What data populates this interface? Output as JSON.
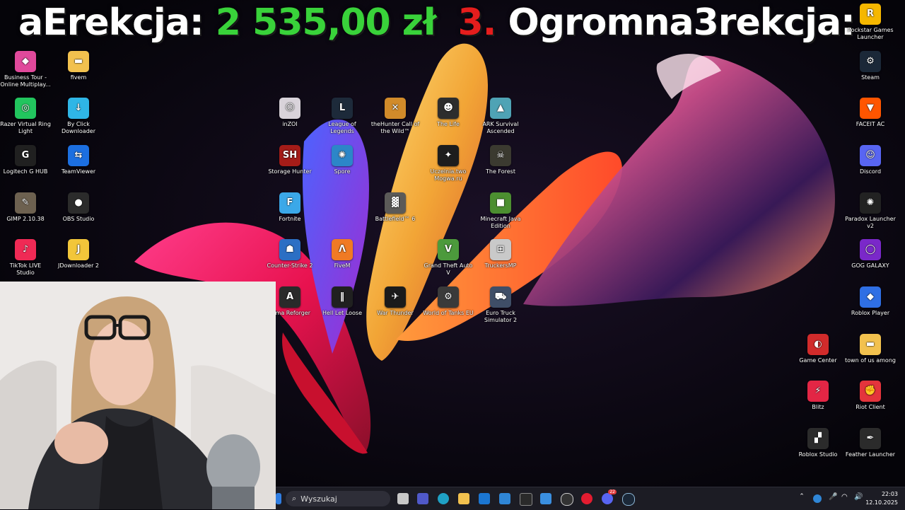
{
  "overlay": {
    "part1": "aErekcja:",
    "amount": "2 535,00 zł",
    "number": "3.",
    "part2": "Ogromna3rekcja:"
  },
  "desktop_icons": [
    {
      "id": "business-tour",
      "label": "Business Tour - Online Multiplay...",
      "color": "#e0499b",
      "glyph": "◆"
    },
    {
      "id": "fivem-folder",
      "label": "fivem",
      "color": "#f2c14e",
      "glyph": "▬"
    },
    {
      "id": "razer-ring-light",
      "label": "Razer Virtual Ring Light",
      "color": "#22c55e",
      "glyph": "◎"
    },
    {
      "id": "by-click-downloader",
      "label": "By Click Downloader",
      "color": "#2fb6e6",
      "glyph": "↓"
    },
    {
      "id": "logitech-g-hub",
      "label": "Logitech G HUB",
      "color": "#202020",
      "glyph": "G"
    },
    {
      "id": "teamviewer",
      "label": "TeamViewer",
      "color": "#1c6fe0",
      "glyph": "⇆"
    },
    {
      "id": "gimp",
      "label": "GIMP 2.10.38",
      "color": "#6d6150",
      "glyph": "✎"
    },
    {
      "id": "obs-studio",
      "label": "OBS Studio",
      "color": "#2b2b2b",
      "glyph": "●"
    },
    {
      "id": "tiktok-live-studio",
      "label": "TikTok LIVE Studio",
      "color": "#ef2a55",
      "glyph": "♪"
    },
    {
      "id": "jdownloader",
      "label": "JDownloader 2",
      "color": "#f2c63a",
      "glyph": "J"
    },
    {
      "id": "inzoi",
      "label": "inZOI",
      "color": "#d9d3da",
      "glyph": "☺"
    },
    {
      "id": "league-of-legends",
      "label": "League of Legends",
      "color": "#1d2a3a",
      "glyph": "L"
    },
    {
      "id": "thehunter",
      "label": "theHunter Call of the Wild™",
      "color": "#d18b2a",
      "glyph": "✕"
    },
    {
      "id": "the-life",
      "label": "The Life",
      "color": "#2d2d2d",
      "glyph": "☻"
    },
    {
      "id": "ark-survival",
      "label": "ARK Survival Ascended",
      "color": "#4fa3b5",
      "glyph": "▲"
    },
    {
      "id": "storage-hunter",
      "label": "Storage Hunter",
      "color": "#a41c18",
      "glyph": "SH"
    },
    {
      "id": "spore",
      "label": "Spore",
      "color": "#2c86c8",
      "glyph": "✺"
    },
    {
      "id": "uczelnia",
      "label": "Uczelnia.two Mogwa.ru",
      "color": "#1d1d1d",
      "glyph": "✦"
    },
    {
      "id": "the-forest",
      "label": "The Forest",
      "color": "#3b3a30",
      "glyph": "☠"
    },
    {
      "id": "fortnite",
      "label": "Fortnite",
      "color": "#3ba8e8",
      "glyph": "F"
    },
    {
      "id": "battlefield-6",
      "label": "Battlefield™ 6",
      "color": "#5b5a58",
      "glyph": "▓"
    },
    {
      "id": "minecraft",
      "label": "Minecraft Java Edition",
      "color": "#4c8f30",
      "glyph": "■"
    },
    {
      "id": "counter-strike-2",
      "label": "Counter-Strike 2",
      "color": "#2c6fc4",
      "glyph": "☗"
    },
    {
      "id": "fivem",
      "label": "FiveM",
      "color": "#f07a24",
      "glyph": "Λ"
    },
    {
      "id": "gta-v",
      "label": "Grand Theft Auto V",
      "color": "#4c9a3c",
      "glyph": "V"
    },
    {
      "id": "truckersmp",
      "label": "TruckersMP",
      "color": "#c9c9c9",
      "glyph": "⊞"
    },
    {
      "id": "arma-reforger",
      "label": "Arma Reforger",
      "color": "#2a2a2a",
      "glyph": "A"
    },
    {
      "id": "hell-let-loose",
      "label": "Hell Let Loose",
      "color": "#202020",
      "glyph": "‖"
    },
    {
      "id": "war-thunder",
      "label": "War Thunder",
      "color": "#1b1b1b",
      "glyph": "✈"
    },
    {
      "id": "world-of-tanks",
      "label": "World of Tanks EU",
      "color": "#3a3a3a",
      "glyph": "⚙"
    },
    {
      "id": "euro-truck-simulator-2",
      "label": "Euro Truck Simulator 2",
      "color": "#3f4e67",
      "glyph": "⛟"
    },
    {
      "id": "rockstar-games-launcher",
      "label": "Rockstar Games Launcher",
      "color": "#f5b700",
      "glyph": "R"
    },
    {
      "id": "steam",
      "label": "Steam",
      "color": "#1b2838",
      "glyph": "⚙"
    },
    {
      "id": "faceit-ac",
      "label": "FACEIT AC",
      "color": "#ff5500",
      "glyph": "▼"
    },
    {
      "id": "discord",
      "label": "Discord",
      "color": "#5865f2",
      "glyph": "☺"
    },
    {
      "id": "paradox-launcher",
      "label": "Paradox Launcher v2",
      "color": "#222222",
      "glyph": "✺"
    },
    {
      "id": "gog-galaxy",
      "label": "GOG GALAXY",
      "color": "#7a28c9",
      "glyph": "◯"
    },
    {
      "id": "roblox-player",
      "label": "Roblox Player",
      "color": "#2f6fe4",
      "glyph": "◆"
    },
    {
      "id": "game-center",
      "label": "Game Center",
      "color": "#d12b2b",
      "glyph": "◐"
    },
    {
      "id": "town-of-us-among",
      "label": "town of us among",
      "color": "#f2c14e",
      "glyph": "▬"
    },
    {
      "id": "blitz",
      "label": "Blitz",
      "color": "#e32645",
      "glyph": "⚡"
    },
    {
      "id": "riot-client",
      "label": "Riot Client",
      "color": "#e4343c",
      "glyph": "✊"
    },
    {
      "id": "roblox-studio",
      "label": "Roblox Studio",
      "color": "#2b2b2b",
      "glyph": "▞"
    },
    {
      "id": "feather-launcher",
      "label": "Feather Launcher",
      "color": "#2b2b2b",
      "glyph": "✒"
    }
  ],
  "taskbar": {
    "search_placeholder": "Wyszukaj",
    "time": "22:03",
    "date": "12.10.2025",
    "discord_badge": "22"
  },
  "colors": {
    "accent_green": "#39d23a",
    "accent_red": "#e51d1d",
    "taskbar_bg": "#1c1c24"
  }
}
